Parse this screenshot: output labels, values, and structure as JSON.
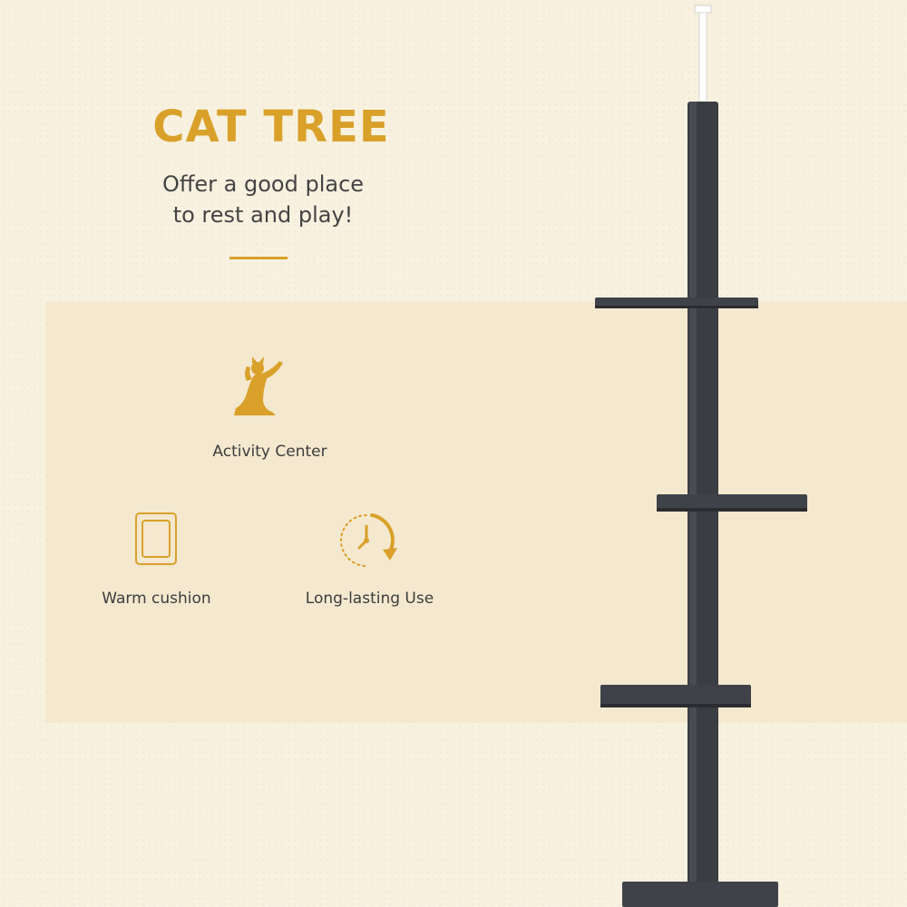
{
  "headline": {
    "title": "CAT TREE",
    "subtitle_line1": "Offer a good place",
    "subtitle_line2": "to rest and play!"
  },
  "features": [
    {
      "icon": "cat-icon",
      "label": "Activity Center"
    },
    {
      "icon": "cushion-icon",
      "label": "Warm cushion"
    },
    {
      "icon": "clock-icon",
      "label": "Long-lasting Use"
    }
  ],
  "colors": {
    "accent": "#d9a12a",
    "background": "#f8f1df",
    "panel": "#f4e8cf",
    "tree": "#3a3d42",
    "text": "#3d3d3d"
  }
}
